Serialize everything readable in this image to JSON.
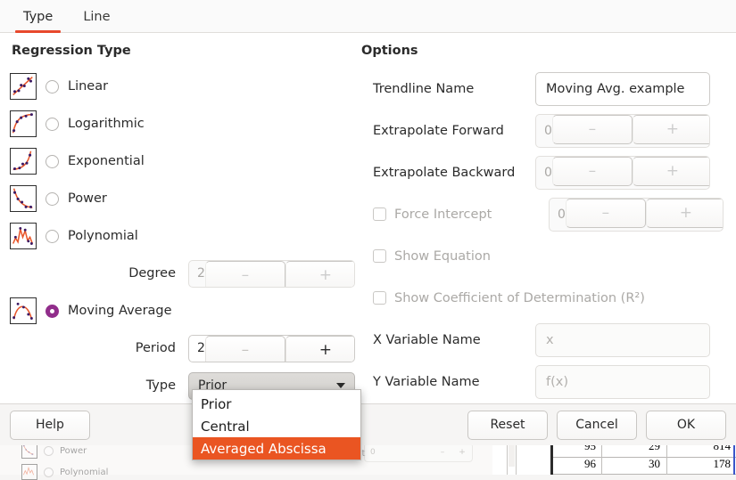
{
  "tabs": [
    {
      "label": "Type",
      "active": true
    },
    {
      "label": "Line",
      "active": false
    }
  ],
  "left": {
    "section_title": "Regression Type",
    "options": [
      {
        "label": "Linear",
        "icon": "linear-trend-thumbnail",
        "selected": false
      },
      {
        "label": "Logarithmic",
        "icon": "logarithmic-trend-thumbnail",
        "selected": false
      },
      {
        "label": "Exponential",
        "icon": "exponential-trend-thumbnail",
        "selected": false
      },
      {
        "label": "Power",
        "icon": "power-trend-thumbnail",
        "selected": false
      },
      {
        "label": "Polynomial",
        "icon": "polynomial-trend-thumbnail",
        "selected": false
      },
      {
        "label": "Moving Average",
        "icon": "moving-average-trend-thumbnail",
        "selected": true
      }
    ],
    "degree": {
      "label": "Degree",
      "value": "2",
      "minus": "–",
      "plus": "+",
      "disabled": true
    },
    "period": {
      "label": "Period",
      "value": "2",
      "minus": "–",
      "plus": "+",
      "disabled": false
    },
    "type": {
      "label": "Type",
      "value": "Prior"
    }
  },
  "dropdown": {
    "items": [
      {
        "label": "Prior",
        "selected": false
      },
      {
        "label": "Central",
        "selected": false
      },
      {
        "label": "Averaged Abscissa",
        "selected": true
      }
    ]
  },
  "right": {
    "section_title": "Options",
    "trendline_name": {
      "label": "Trendline Name",
      "value": "Moving Avg. example",
      "placeholder": ""
    },
    "extrapolate_forward": {
      "label": "Extrapolate Forward",
      "value": "0",
      "minus": "–",
      "plus": "+",
      "disabled": true
    },
    "extrapolate_backward": {
      "label": "Extrapolate Backward",
      "value": "0",
      "minus": "–",
      "plus": "+",
      "disabled": true
    },
    "force_intercept": {
      "label": "Force Intercept",
      "value": "0",
      "minus": "–",
      "plus": "+",
      "checked": false,
      "disabled": true
    },
    "show_equation": {
      "label": "Show Equation",
      "checked": false,
      "disabled": true
    },
    "show_r2": {
      "label": "Show Coefficient of Determination (R²)",
      "checked": false,
      "disabled": true
    },
    "x_variable_name": {
      "label": "X Variable Name",
      "value": "",
      "placeholder": "x"
    },
    "y_variable_name": {
      "label": "Y Variable Name",
      "value": "",
      "placeholder": "f(x)"
    }
  },
  "footer": {
    "help": "Help",
    "reset": "Reset",
    "cancel": "Cancel",
    "ok": "OK"
  },
  "background": {
    "ghost_labels": {
      "power": "Power",
      "polynomial": "Polynomial",
      "force_intercept": "Force Intercept",
      "zero": "0"
    },
    "spreadsheet": {
      "rows": [
        {
          "row": "95",
          "col_b": "29",
          "col_c": "814"
        },
        {
          "row": "96",
          "col_b": "30",
          "col_c": "178"
        }
      ]
    }
  },
  "colors": {
    "accent_tab": "#e8492d",
    "selection": "#ea5522",
    "radio_selected": "#912d8b",
    "chart_line": "#e8562a",
    "chart_point": "#3c1a63"
  }
}
